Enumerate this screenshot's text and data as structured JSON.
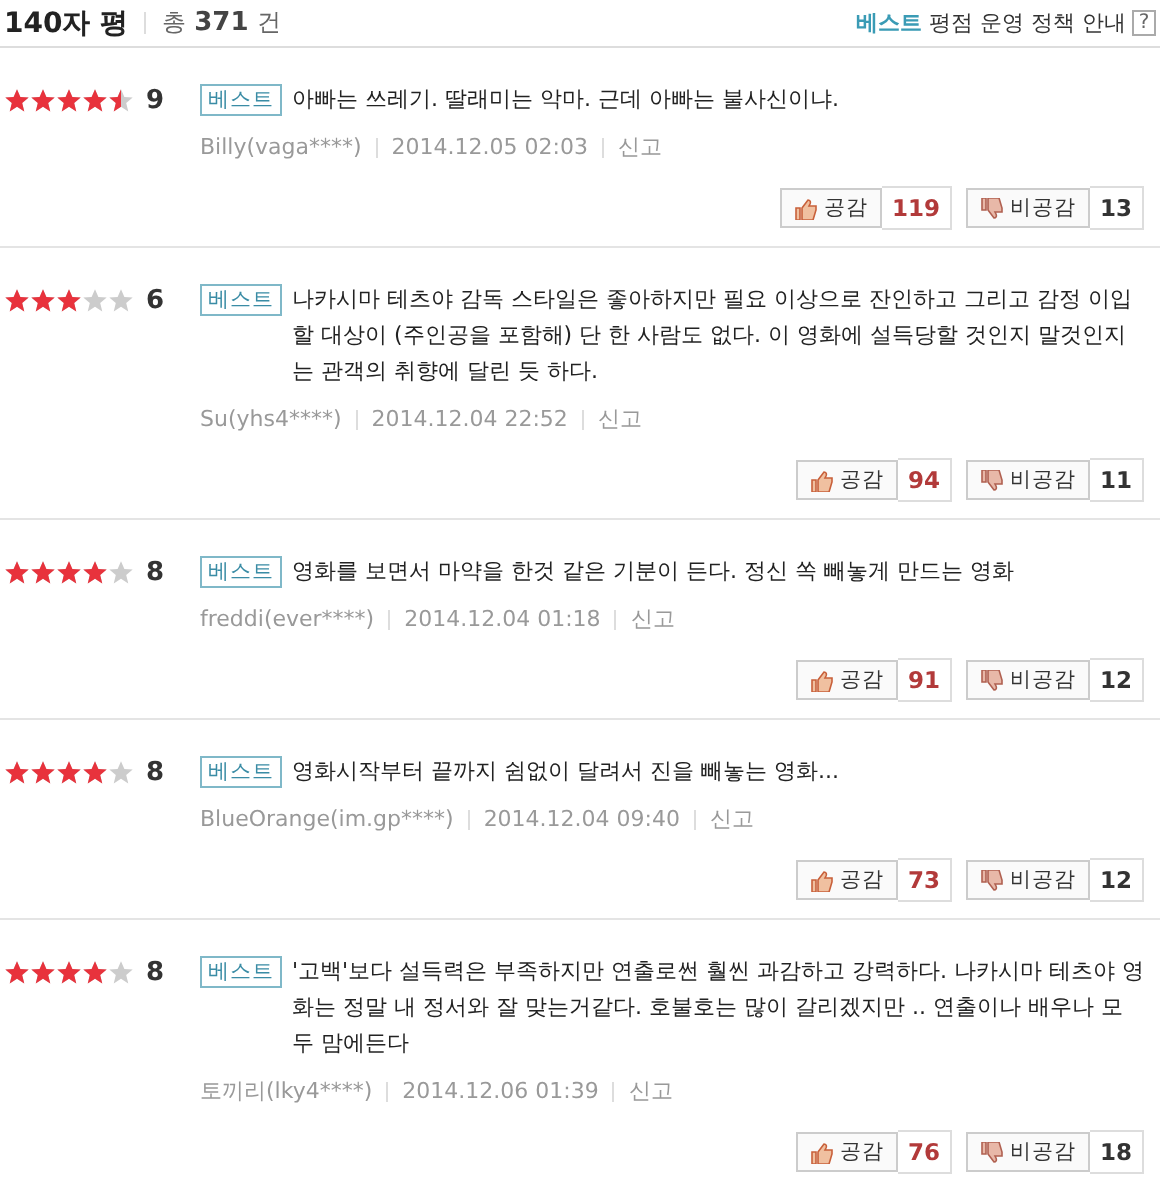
{
  "header": {
    "title": "140자 평",
    "total_label": "총",
    "total_count": "371",
    "total_unit": "건",
    "policy_highlight": "베스트",
    "policy_text": "평점 운영 정책 안내",
    "help": "?"
  },
  "reviews": [
    {
      "stars": 4.5,
      "score": "9",
      "badge": "베스트",
      "text": "아빠는 쓰레기. 딸래미는 악마. 근데 아빠는 불사신이냐.",
      "author": "Billy(vaga****)",
      "date": "2014.12.05 02:03",
      "report": "신고",
      "like_label": "공감",
      "likes": "119",
      "dislike_label": "비공감",
      "dislikes": "13"
    },
    {
      "stars": 3,
      "score": "6",
      "badge": "베스트",
      "text": "나카시마 테츠야 감독 스타일은 좋아하지만 필요 이상으로 잔인하고 그리고 감정 이입할 대상이 (주인공을 포함해) 단 한 사람도 없다. 이 영화에 설득당할 것인지 말것인지는 관객의 취향에 달린 듯 하다.",
      "author": "Su(yhs4****)",
      "date": "2014.12.04 22:52",
      "report": "신고",
      "like_label": "공감",
      "likes": "94",
      "dislike_label": "비공감",
      "dislikes": "11"
    },
    {
      "stars": 4,
      "score": "8",
      "badge": "베스트",
      "text": "영화를 보면서 마약을 한것 같은 기분이 든다. 정신 쏙 빼놓게 만드는 영화",
      "author": "freddi(ever****)",
      "date": "2014.12.04 01:18",
      "report": "신고",
      "like_label": "공감",
      "likes": "91",
      "dislike_label": "비공감",
      "dislikes": "12"
    },
    {
      "stars": 4,
      "score": "8",
      "badge": "베스트",
      "text": "영화시작부터 끝까지 쉼없이 달려서 진을 빼놓는 영화...",
      "author": "BlueOrange(im.gp****)",
      "date": "2014.12.04 09:40",
      "report": "신고",
      "like_label": "공감",
      "likes": "73",
      "dislike_label": "비공감",
      "dislikes": "12"
    },
    {
      "stars": 4,
      "score": "8",
      "badge": "베스트",
      "text": "'고백'보다 설득력은 부족하지만 연출로썬 훨씬 과감하고 강력하다. 나카시마 테츠야 영화는 정말 내 정서와 잘 맞는거같다. 호불호는 많이 갈리겠지만 .. 연출이나 배우나 모두 맘에든다",
      "author": "토끼리(lky4****)",
      "date": "2014.12.06 01:39",
      "report": "신고",
      "like_label": "공감",
      "likes": "76",
      "dislike_label": "비공감",
      "dislikes": "18"
    }
  ]
}
